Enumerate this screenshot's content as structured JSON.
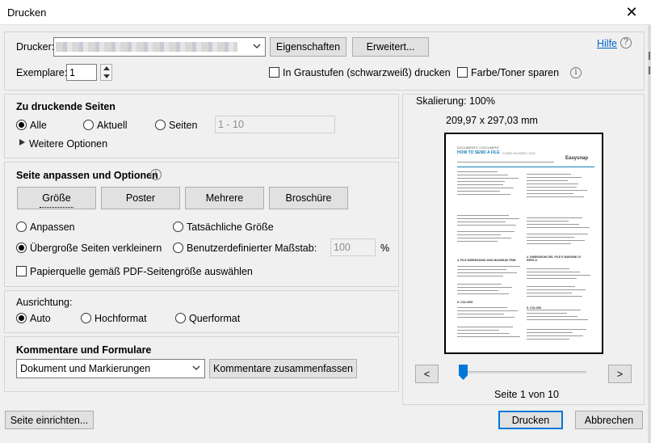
{
  "window": {
    "title": "Drucken",
    "close_glyph": "✕"
  },
  "printer": {
    "label": "Drucker:",
    "properties_button": "Eigenschaften",
    "advanced_button": "Erweitert...",
    "help_link": "Hilfe",
    "help_icon": "?",
    "copies_label": "Exemplare:",
    "copies_value": "1",
    "grayscale_label": "In Graustufen (schwarzweiß) drucken",
    "grayscale_checked": false,
    "save_ink_label": "Farbe/Toner sparen",
    "save_ink_checked": false
  },
  "pages": {
    "heading": "Zu druckende Seiten",
    "all_label": "Alle",
    "current_label": "Aktuell",
    "pages_label": "Seiten",
    "pages_placeholder": "1 - 10",
    "selected": "all",
    "more_options": "Weitere Optionen"
  },
  "sizing": {
    "heading": "Seite anpassen und Optionen",
    "tabs": [
      "Größe",
      "Poster",
      "Mehrere",
      "Broschüre"
    ],
    "fit_label": "Anpassen",
    "actual_size_label": "Tatsächliche Größe",
    "shrink_label": "Übergroße Seiten verkleinern",
    "custom_scale_label": "Benutzerdefinierter Maßstab:",
    "custom_scale_value": "100",
    "percent": "%",
    "selected": "shrink",
    "paper_source_label": "Papierquelle gemäß PDF-Seitengröße auswählen",
    "paper_source_checked": false
  },
  "orientation": {
    "heading": "Ausrichtung:",
    "auto_label": "Auto",
    "portrait_label": "Hochformat",
    "landscape_label": "Querformat",
    "selected": "auto"
  },
  "comments": {
    "heading": "Kommentare und Formulare",
    "select_value": "Dokument und Markierungen",
    "summarize_button": "Kommentare zusammenfassen"
  },
  "preview": {
    "scaling": "Skalierung: 100%",
    "dimensions": "209,97 x 297,03 mm",
    "prev_button": "<",
    "next_button": ">",
    "page_status": "Seite 1 von 10",
    "slider_fraction": 0.0,
    "doc_header": "DOCUMENTS / DOCUMENT",
    "doc_title": "HOW TO SEND A FILE",
    "doc_subtitle": "COME INVIARE I FILE",
    "doc_brand": "Easysnap",
    "sections": [
      "4. FILE DIMENSIONS AND MAXIMUM TRIM",
      "4. DIMENSIONI DEL FILE E MARGINI DI REFILO",
      "5. COLORS",
      "5. COLORI"
    ]
  },
  "footer": {
    "page_setup_button": "Seite einrichten...",
    "print_button": "Drucken",
    "cancel_button": "Abbrechen"
  }
}
